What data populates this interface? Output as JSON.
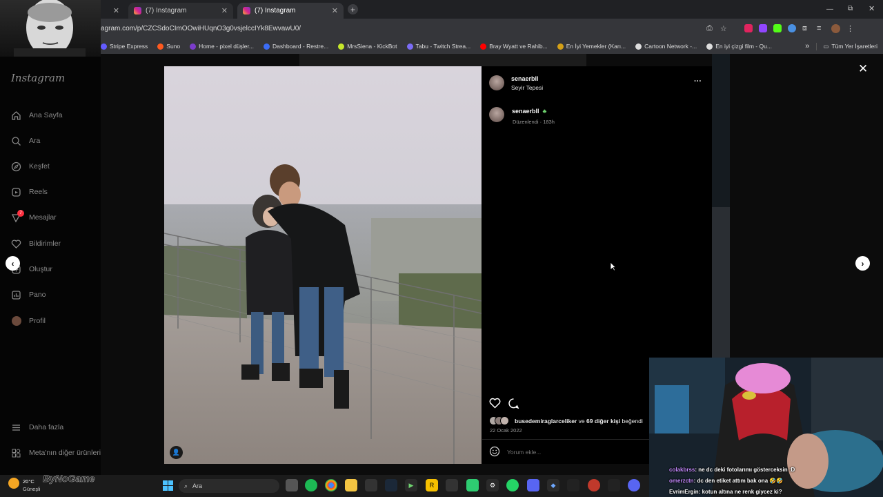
{
  "browser": {
    "tabs": [
      {
        "title": ""
      },
      {
        "title": "(7) Instagram"
      },
      {
        "title": "(7) Instagram"
      }
    ],
    "new_tab": "+",
    "url": "agram.com/p/CZCSdoCImOOwiHUqnO3g0vsjelccIYk8EwvawU0/",
    "bookmarks": [
      "Stripe Express",
      "Suno",
      "Home - pixel düşler...",
      "Dashboard - Restre...",
      "MrsSiena - KickBot",
      "Tabu - Twitch Strea...",
      "Bray Wyatt ve Rahib...",
      "En İyi Yemekler (Karı...",
      "Cartoon Network -...",
      "En iyi çizgi film - Qu..."
    ],
    "bookmarks_more": "»",
    "all_bookmarks": "Tüm Yer İşaretleri"
  },
  "sidebar": {
    "logo": "Instagram",
    "items": [
      {
        "label": "Ana Sayfa",
        "icon": "home-icon"
      },
      {
        "label": "Ara",
        "icon": "search-icon"
      },
      {
        "label": "Keşfet",
        "icon": "compass-icon"
      },
      {
        "label": "Reels",
        "icon": "reels-icon"
      },
      {
        "label": "Mesajlar",
        "icon": "messenger-icon",
        "badge": "7"
      },
      {
        "label": "Bildirimler",
        "icon": "heart-icon"
      },
      {
        "label": "Oluştur",
        "icon": "plus-icon"
      },
      {
        "label": "Pano",
        "icon": "chart-icon"
      },
      {
        "label": "Profil",
        "icon": "avatar-icon"
      }
    ],
    "more": "Daha fazla",
    "meta": "Meta'nın diğer ürünleri"
  },
  "post": {
    "username": "senaerbll",
    "location": "Seyir Tepesi",
    "options": "···",
    "comment_user": "senaerbll",
    "comment_meta": "Düzenlendi · 183h",
    "likes_user": "busedemiraglarceliker",
    "likes_rest": "ve",
    "likes_count": "69 diğer kişi",
    "likes_tail": "beğendi",
    "date": "22 Ocak 2022",
    "comment_placeholder": "Yorum ekle..."
  },
  "chat": [
    {
      "user": "colakbrss",
      "text": ": ne dc deki fotolarımı gösterceksin :D"
    },
    {
      "user": "omerzctn",
      "text": ": dc den etiket attım bak ona 🤣🤣"
    },
    {
      "user": "EvrimErgin",
      "text": ": kotun altına ne renk giycez ki?"
    }
  ],
  "overlay_text": "ByNoGame",
  "taskbar": {
    "weather_temp": "20°C",
    "weather_desc": "Güneşli",
    "search": "Ara"
  },
  "colors": {
    "instagram_accent": "#d6248c",
    "panel_bg": "#000000",
    "text_muted": "#8a8a8a"
  }
}
